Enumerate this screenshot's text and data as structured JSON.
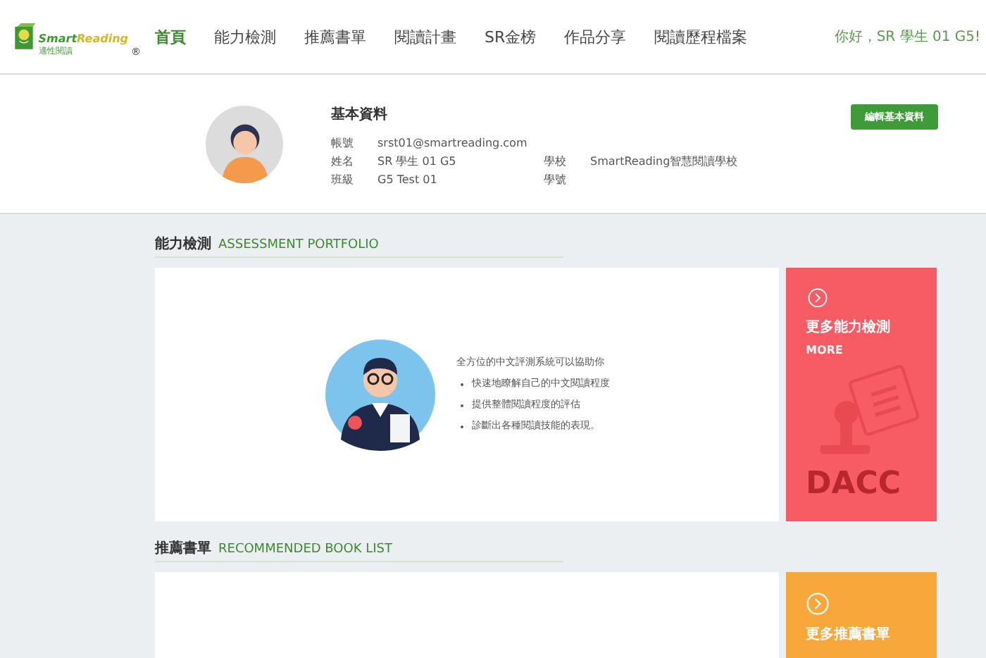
{
  "logo": {
    "word_1": "Smart",
    "word_2": "Reading",
    "subtitle": "適性閱讀",
    "mark": "®"
  },
  "nav": [
    {
      "label": "首頁",
      "selected": true
    },
    {
      "label": "能力檢測",
      "selected": false
    },
    {
      "label": "推薦書單",
      "selected": false
    },
    {
      "label": "閱讀計畫",
      "selected": false
    },
    {
      "label": "SR金榜",
      "selected": false
    },
    {
      "label": "作品分享",
      "selected": false
    },
    {
      "label": "閱讀歷程檔案",
      "selected": false
    }
  ],
  "greeting": "你好，SR 學生 01 G5!",
  "profile": {
    "title": "基本資料",
    "edit_button": "編輯基本資料",
    "rows": [
      [
        {
          "label": "帳號",
          "value": "srst01@smartreading.com"
        }
      ],
      [
        {
          "label": "姓名",
          "value": "SR 學生 01 G5"
        },
        {
          "label": "學校",
          "value": "SmartReading智慧閱讀學校"
        }
      ],
      [
        {
          "label": "班級",
          "value": "G5 Test 01"
        },
        {
          "label": "學號"
        }
      ]
    ]
  },
  "sections": [
    {
      "kind": "assessment",
      "title": "能力檢測",
      "subtitle": "ASSESSMENT PORTFOLIO",
      "intro": "全方位的中文評測系統可以協助你",
      "bullets": [
        "快速地瞭解自己的中文閱讀程度",
        "提供整體閱讀程度的評估",
        "診斷出各種閱讀技能的表現。"
      ],
      "more_title": "更多能力檢測",
      "more_label": "MORE",
      "stamp_text": "DACC",
      "color": "#f75c64"
    },
    {
      "kind": "books",
      "title": "推薦書單",
      "subtitle": "RECOMMENDED BOOK LIST",
      "more_title": "更多推薦書單",
      "color": "#f8a83a"
    }
  ]
}
